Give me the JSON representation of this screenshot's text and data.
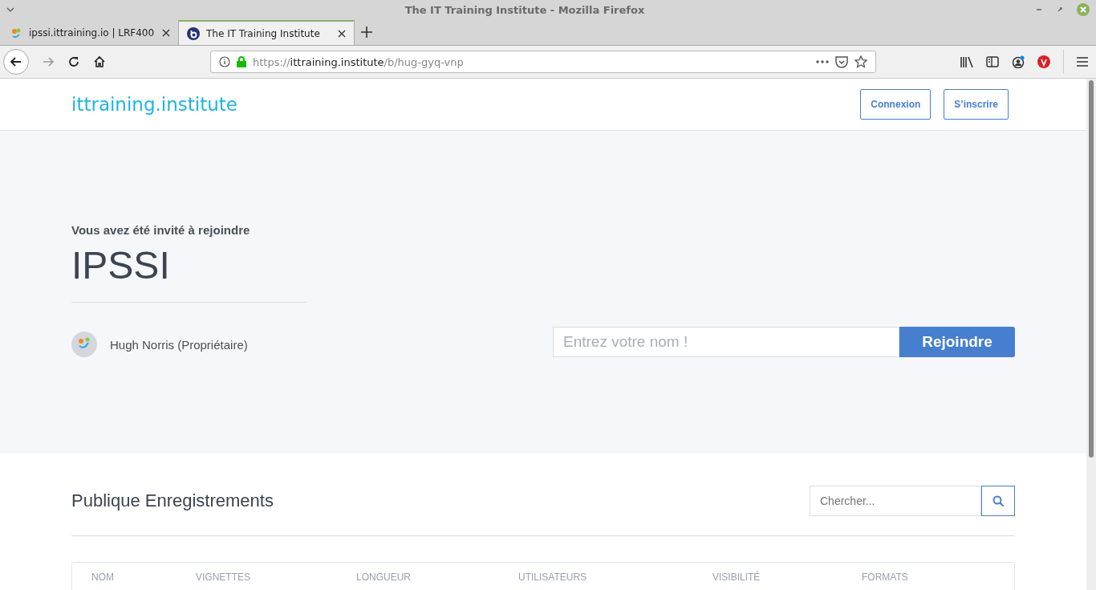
{
  "window": {
    "title": "The IT Training Institute - Mozilla Firefox"
  },
  "tabs": [
    {
      "label": "ipssi.ittraining.io | LRF400",
      "selected": false
    },
    {
      "label": "The IT Training Institute",
      "selected": true
    }
  ],
  "url": {
    "scheme": "https://",
    "host": "ittraining.institute",
    "path": "/b/hug-gyq-vnp"
  },
  "header": {
    "logo": "ittraining.institute",
    "buttons": [
      "Connexion",
      "S’inscrire"
    ]
  },
  "invite": {
    "intro": "Vous avez été invité à rejoindre",
    "room": "IPSSI",
    "owner": "Hugh Norris (Propriétaire)",
    "name_placeholder": "Entrez votre nom !",
    "join_button": "Rejoindre"
  },
  "recordings": {
    "title": "Publique Enregistrements",
    "search_placeholder": "Chercher...",
    "columns": [
      "NOM",
      "VIGNETTES",
      "LONGUEUR",
      "UTILISATEURS",
      "VISIBILITÉ",
      "FORMATS"
    ]
  }
}
